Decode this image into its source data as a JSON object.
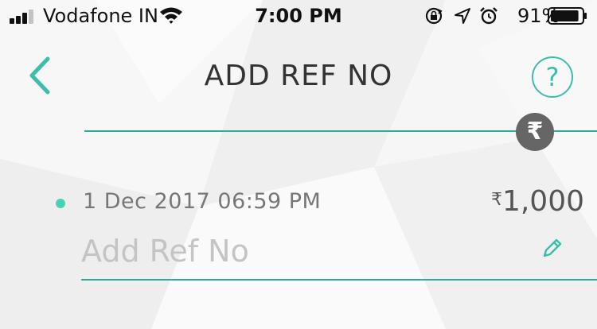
{
  "status_bar": {
    "carrier": "Vodafone IN",
    "time": "7:00 PM",
    "battery_percent": "91%",
    "signal_bars_filled": 3,
    "signal_bars_total": 4,
    "battery_level": 0.91,
    "icons": [
      "signal-icon",
      "wifi-icon",
      "orientation-lock-icon",
      "location-arrow-icon",
      "alarm-icon",
      "battery-icon"
    ]
  },
  "header": {
    "title": "ADD REF NO",
    "back_icon": "chevron-left-icon",
    "help_glyph": "?"
  },
  "badge": {
    "currency_glyph": "₹"
  },
  "transaction": {
    "datetime": "1 Dec 2017 06:59 PM",
    "currency_symbol": "₹",
    "amount": "1,000",
    "ref_value": "",
    "ref_placeholder": "Add Ref No",
    "edit_icon": "pencil-icon"
  },
  "colors": {
    "accent": "#3dbdac",
    "divider": "#30a999",
    "status_dot": "#4ccfb8",
    "badge_bg": "#666666"
  }
}
